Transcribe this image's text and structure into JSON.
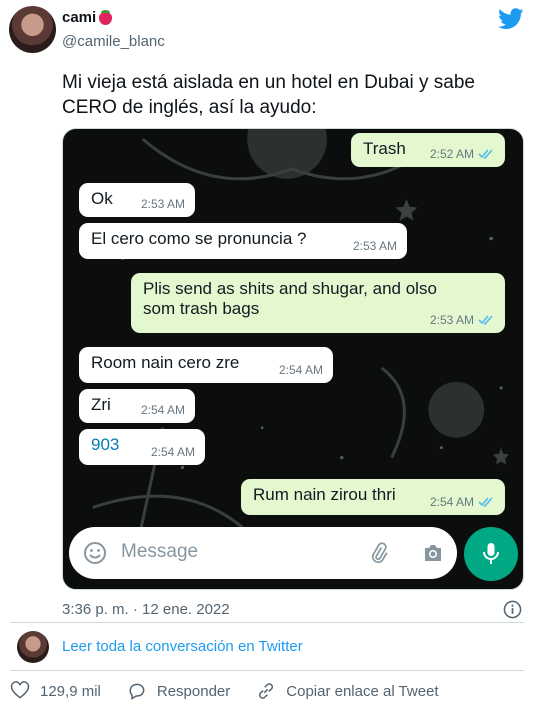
{
  "tweet": {
    "author_name": "cami",
    "author_emoji": "strawberry",
    "handle": "@camile_blanc",
    "text": "Mi vieja está aislada en un hotel en Dubai y sabe CERO de inglés, así la ayudo:",
    "timestamp": "3:36 p. m. · 12 ene. 2022",
    "read_conversation": "Leer toda la conversación en Twitter",
    "actions": {
      "likes": "129,9 mil",
      "reply": "Responder",
      "copy_link": "Copiar enlace al Tweet"
    },
    "colors": {
      "twitter_blue": "#1d9bf0",
      "like_red": "#e0245e"
    }
  },
  "chat": {
    "messages": [
      {
        "dir": "out",
        "text": "Trash",
        "time": "2:52 AM",
        "read": true
      },
      {
        "dir": "in",
        "text": "Ok",
        "time": "2:53 AM"
      },
      {
        "dir": "in",
        "text": "El cero como se pronuncia ?",
        "time": "2:53 AM"
      },
      {
        "dir": "out",
        "text": "Plis send as shits and shugar, and olso",
        "text2": "som trash bags",
        "time": "2:53 AM",
        "read": true
      },
      {
        "dir": "in",
        "text": "Room nain cero zre",
        "time": "2:54 AM"
      },
      {
        "dir": "in",
        "text": "Zri",
        "time": "2:54 AM"
      },
      {
        "dir": "in",
        "text": "903",
        "time": "2:54 AM",
        "link": true
      },
      {
        "dir": "out",
        "text": "Rum nain zirou thri",
        "time": "2:54 AM",
        "read": true
      }
    ],
    "composer_placeholder": "Message",
    "colors": {
      "incoming": "#ffffff",
      "outgoing": "#e3f8cf",
      "read_ticks": "#53bdeb",
      "mic": "#00a884"
    }
  }
}
